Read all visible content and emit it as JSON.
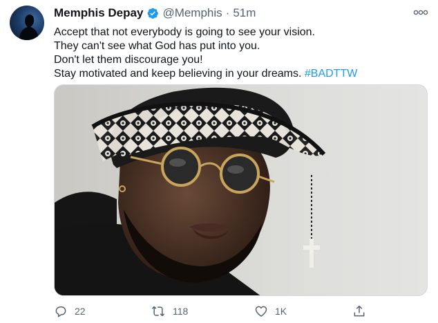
{
  "author": {
    "name": "Memphis Depay",
    "handle": "@Memphis",
    "separator": "·",
    "time": "51m"
  },
  "tweet": {
    "lines": [
      "Accept that not everybody is going to see your vision.",
      "They can't see what God has put into you.",
      "Don't let them discourage you!",
      "Stay motivated and keep believing in your dreams."
    ],
    "hashtag": "#BADTTW"
  },
  "actions": {
    "reply_count": "22",
    "retweet_count": "118",
    "like_count": "1K"
  },
  "colors": {
    "link": "#1d9bf0",
    "verified": "#1d9bf0",
    "muted": "#536471"
  },
  "icons": [
    "more-icon",
    "verified-badge-icon",
    "reply-icon",
    "retweet-icon",
    "like-icon",
    "share-icon"
  ]
}
